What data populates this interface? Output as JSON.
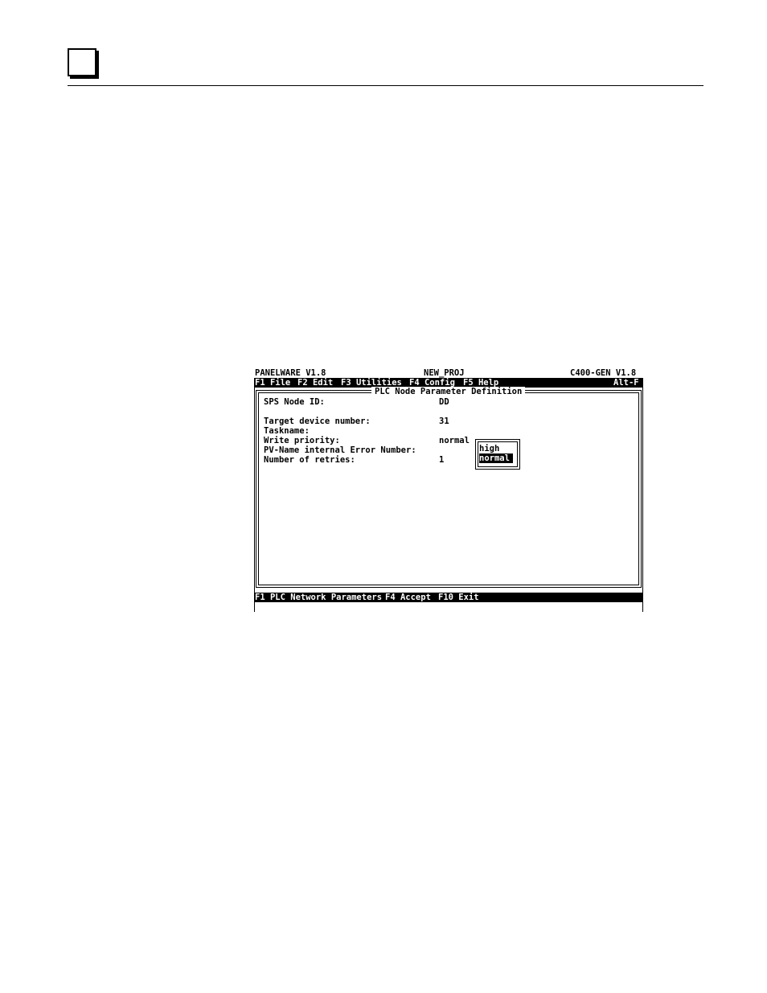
{
  "titlebar": {
    "app": "PANELWARE V1.8",
    "project": "NEW_PROJ",
    "target": "C400-GEN V1.8"
  },
  "menubar": {
    "items": [
      "F1 File",
      "F2 Edit",
      "F3 Utilities",
      "F4 Config",
      "F5 Help"
    ],
    "shortcut": "Alt-F"
  },
  "dialog": {
    "title": "PLC Node Parameter Definition",
    "fields": [
      {
        "label": "SPS Node ID:",
        "value": "DD"
      },
      {
        "label": "Target device number:",
        "value": "31"
      },
      {
        "label": "Taskname:",
        "value": ""
      },
      {
        "label": "Write priority:",
        "value": "normal"
      },
      {
        "label": "PV-Name internal Error Number:",
        "value": ""
      },
      {
        "label": "Number of retries:",
        "value": "1"
      }
    ]
  },
  "popup": {
    "options": [
      "high",
      "normal"
    ],
    "selected": "normal"
  },
  "statusbar": {
    "keys": [
      "F1 PLC Network Parameters",
      "F4 Accept",
      "F10 Exit"
    ]
  }
}
